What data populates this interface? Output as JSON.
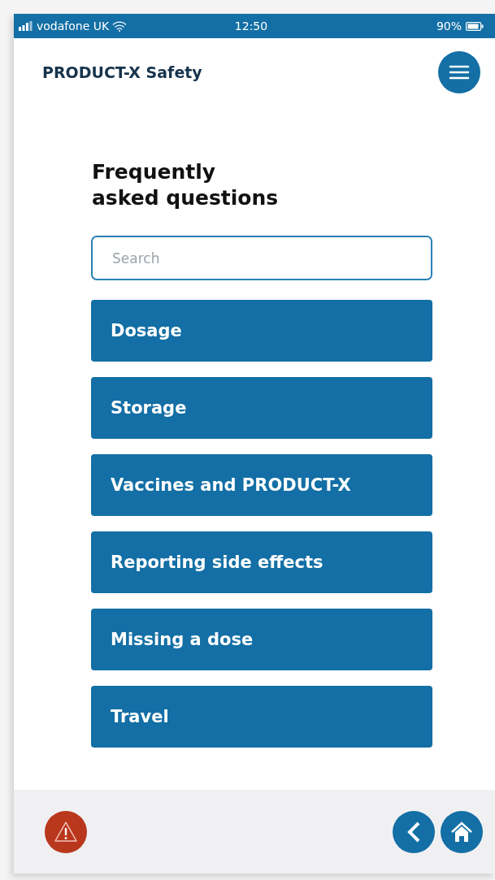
{
  "status_bar": {
    "carrier": "vodafone UK",
    "time": "12:50",
    "battery": "90%"
  },
  "header": {
    "title": "PRODUCT-X Safety"
  },
  "heading": "Frequently\nasked questions",
  "search": {
    "placeholder": "Search"
  },
  "topics": [
    {
      "label": "Dosage"
    },
    {
      "label": "Storage"
    },
    {
      "label": "Vaccines and PRODUCT-X"
    },
    {
      "label": "Reporting side effects"
    },
    {
      "label": "Missing a dose"
    },
    {
      "label": "Travel"
    }
  ]
}
